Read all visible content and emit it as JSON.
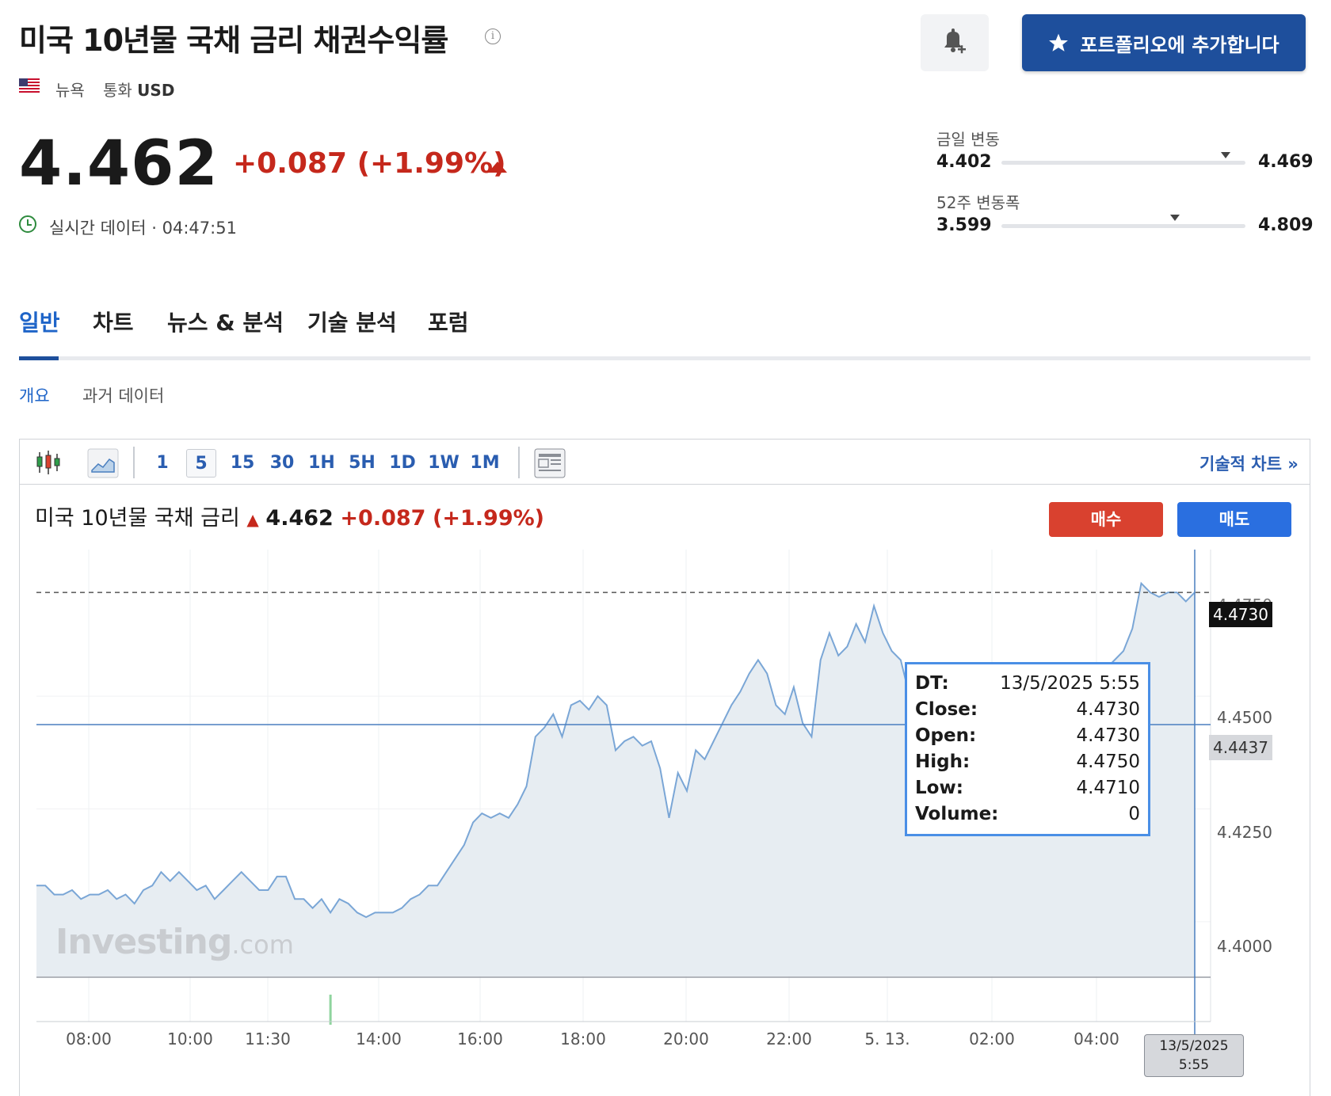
{
  "header": {
    "title": "미국 10년물 국채 금리 채권수익률",
    "location": "뉴욕",
    "currency_label": "통화",
    "currency": "USD",
    "portfolio_button": "포트폴리오에 추가합니다"
  },
  "quote": {
    "price": "4.462",
    "change": "+0.087 (+1.99%)",
    "realtime": "실시간 데이터 · 04:47:51"
  },
  "ranges": {
    "day_label": "금일 변동",
    "day_low": "4.402",
    "day_high": "4.469",
    "day_position": 0.92,
    "week52_label": "52주 변동폭",
    "week52_low": "3.599",
    "week52_high": "4.809",
    "week52_position": 0.71
  },
  "tabs": [
    "일반",
    "차트",
    "뉴스 & 분석",
    "기술 분석",
    "포럼"
  ],
  "subtabs": [
    "개요",
    "과거 데이터"
  ],
  "toolbar": {
    "intervals": [
      "1",
      "5",
      "15",
      "30",
      "1H",
      "5H",
      "1D",
      "1W",
      "1M"
    ],
    "selected_interval": "5",
    "tech_chart": "기술적 차트 »"
  },
  "chart_header": {
    "name": "미국 10년물 국채 금리",
    "price": "4.462",
    "change": "+0.087",
    "change_pct": "(+1.99%)",
    "buy": "매수",
    "sell": "매도"
  },
  "chart_data": {
    "type": "area",
    "x_ticks": [
      "08:00",
      "10:00",
      "11:30",
      "14:00",
      "16:00",
      "18:00",
      "20:00",
      "22:00",
      "5. 13.",
      "02:00",
      "04:00"
    ],
    "y_ticks": [
      "4.4000",
      "4.4250",
      "4.4500"
    ],
    "ylim": [
      4.3875,
      4.4825
    ],
    "series": [
      {
        "values": [
          4.408,
          4.408,
          4.406,
          4.406,
          4.407,
          4.405,
          4.406,
          4.406,
          4.407,
          4.405,
          4.406,
          4.404,
          4.407,
          4.408,
          4.411,
          4.409,
          4.411,
          4.409,
          4.407,
          4.408,
          4.405,
          4.407,
          4.409,
          4.411,
          4.409,
          4.407,
          4.407,
          4.41,
          4.41,
          4.405,
          4.405,
          4.403,
          4.405,
          4.402,
          4.405,
          4.404,
          4.402,
          4.401,
          4.402,
          4.402,
          4.402,
          4.403,
          4.405,
          4.406,
          4.408,
          4.408,
          4.411,
          4.414,
          4.417,
          4.422,
          4.424,
          4.423,
          4.424,
          4.423,
          4.426,
          4.43,
          4.441,
          4.443,
          4.446,
          4.441,
          4.448,
          4.449,
          4.447,
          4.45,
          4.448,
          4.438,
          4.44,
          4.441,
          4.439,
          4.44,
          4.434,
          4.423,
          4.433,
          4.429,
          4.438,
          4.436,
          4.44,
          4.444,
          4.448,
          4.451,
          4.455,
          4.458,
          4.455,
          4.448,
          4.446,
          4.452,
          4.444,
          4.441,
          4.458,
          4.464,
          4.459,
          4.461,
          4.466,
          4.462,
          4.47,
          4.464,
          4.46,
          4.458,
          4.45,
          4.447,
          4.451,
          4.446,
          4.441,
          4.441,
          4.437,
          4.435,
          4.437,
          4.444,
          4.443,
          4.444,
          4.442,
          4.446,
          4.45,
          4.451,
          4.448,
          4.45,
          4.452,
          4.45,
          4.452,
          4.454,
          4.456,
          4.458,
          4.46,
          4.465,
          4.475,
          4.473,
          4.472,
          4.473,
          4.473,
          4.471,
          4.473
        ]
      }
    ],
    "reference_value": 4.4437,
    "crosshair_value": 4.473,
    "crosshair_time": "13/5/2025 5:55",
    "volume_bar_index": 33
  },
  "tooltip": [
    {
      "k": "DT:",
      "v": "13/5/2025 5:55"
    },
    {
      "k": "Close:",
      "v": "4.4730"
    },
    {
      "k": "Open:",
      "v": "4.4730"
    },
    {
      "k": "High:",
      "v": "4.4750"
    },
    {
      "k": "Low:",
      "v": "4.4710"
    },
    {
      "k": "Volume:",
      "v": "0"
    }
  ],
  "price_tags": {
    "crosshair": "4.4730",
    "reference": "4.4437",
    "hidden_tick": "4.4750"
  },
  "time_tag": [
    "13/5/2025",
    "5:55"
  ],
  "watermark": {
    "brand": "Investing",
    "suffix": ".com"
  },
  "colors": {
    "accent": "#1e4f9c",
    "negative_red": "#c5281c",
    "buy": "#d9412f",
    "sell": "#2a6fe0",
    "line": "#7aa6d6",
    "area": "#e7edf2"
  }
}
